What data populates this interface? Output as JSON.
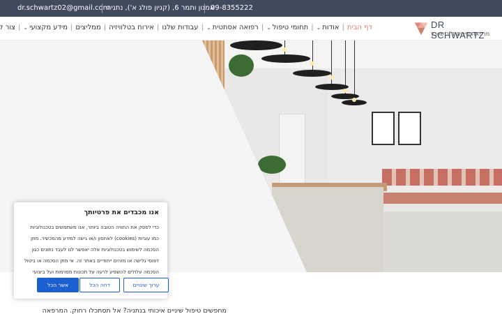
{
  "topbar": {
    "email": "dr.schwartz02@gmail.com",
    "address": "אמנון ותמר 6, (קניון פולג א'), נתניה",
    "phone": "09-8355222"
  },
  "logo": {
    "name": "DR SCHWARTZ",
    "subtitle": "מרפאת שיניים ד\"ר שוורץ"
  },
  "nav": {
    "items": [
      {
        "label": "דף הבית",
        "dropdown": false,
        "active": true
      },
      {
        "label": "אודות",
        "dropdown": true
      },
      {
        "label": "תחומי טיפול",
        "dropdown": true
      },
      {
        "label": "רפואה אסתטית",
        "dropdown": true
      },
      {
        "label": "עבודות שלנו",
        "dropdown": false
      },
      {
        "label": "אירוח בטלוויזיה",
        "dropdown": false
      },
      {
        "label": "ממליצים",
        "dropdown": false
      },
      {
        "label": "מידע מקצועי",
        "dropdown": true
      },
      {
        "label": "צור קשר",
        "dropdown": false
      }
    ]
  },
  "cookie": {
    "title": "אנו מכבדים את פרטיותך",
    "text": "כדי לספק את החוויה הטובה ביותר, אנו משתמשים בטכנולוגיות כמו עוגיות (cookies) לאחסון ו/או גישה למידע מהמכשיר. מתן הסכמה לשימוש בטכנולוגיות אלה יאפשר לנו לעבד נתונים כגון דפוסי גלישה או מזהים ייחודיים באתר זה. אי מתן הסכמה או ביטול הסכמה עלולים להשפיע לרעה על תכונות מסוימות ועל ביצועי האתר.",
    "settings_label": "ערוך שינויים",
    "reject_label": "דחה הכל",
    "accept_label": "אשר הכל"
  },
  "intro_text": "מחפשים טיפול שיניים איכותי בנתניה? אל תסתכלו רחוק. המרפאה",
  "colors": {
    "topbar_bg": "#3f4a5f",
    "accent": "#e07a6a",
    "primary_button": "#1b5fd1"
  }
}
